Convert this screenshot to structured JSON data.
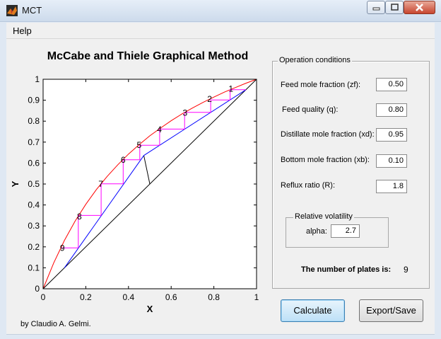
{
  "window": {
    "title": "MCT",
    "icon": "matlab-icon",
    "controls": [
      "minimize-icon",
      "maximize-icon",
      "close-icon"
    ]
  },
  "menu": {
    "help": "Help"
  },
  "chart_title": "McCabe and Thiele Graphical Method",
  "credit": "by Claudio A. Gelmi.",
  "operation_conditions": {
    "title": "Operation conditions",
    "fields": [
      {
        "label": "Feed mole fraction (zf):",
        "value": "0.50"
      },
      {
        "label": "Feed quality (q):",
        "value": "0.80"
      },
      {
        "label": "Distillate mole fraction (xd):",
        "value": "0.95"
      },
      {
        "label": "Bottom mole fraction (xb):",
        "value": "0.10"
      },
      {
        "label": "Reflux ratio (R):",
        "value": "1.8"
      }
    ],
    "volatility": {
      "title": "Relative volatility",
      "label": "alpha:",
      "value": "2.7"
    },
    "plates_label": "The number of plates is:",
    "plates_value": "9"
  },
  "buttons": {
    "calculate": "Calculate",
    "export": "Export/Save"
  },
  "colors": {
    "equilibrium": "#ff0000",
    "operating": "#0000ff",
    "steps": "#ff00ff",
    "diagonal": "#000000"
  },
  "chart_data": {
    "type": "line",
    "title": "McCabe and Thiele Graphical Method",
    "xlabel": "X",
    "ylabel": "Y",
    "xlim": [
      0,
      1
    ],
    "ylim": [
      0,
      1
    ],
    "x_ticks": [
      "0",
      "0.2",
      "0.4",
      "0.6",
      "0.8",
      "1"
    ],
    "y_ticks": [
      "0",
      "0.1",
      "0.2",
      "0.3",
      "0.4",
      "0.5",
      "0.6",
      "0.7",
      "0.8",
      "0.9",
      "1"
    ],
    "alpha": 2.7,
    "series": [
      {
        "role": "equilibrium",
        "color": "#ff0000",
        "x": [
          0,
          0.05,
          0.1,
          0.15,
          0.2,
          0.25,
          0.3,
          0.35,
          0.4,
          0.45,
          0.5,
          0.55,
          0.6,
          0.65,
          0.7,
          0.75,
          0.8,
          0.85,
          0.9,
          0.95,
          1
        ],
        "y": [
          0,
          0.124,
          0.231,
          0.323,
          0.403,
          0.474,
          0.536,
          0.592,
          0.643,
          0.688,
          0.73,
          0.767,
          0.802,
          0.834,
          0.863,
          0.89,
          0.915,
          0.939,
          0.96,
          0.981,
          1
        ]
      },
      {
        "role": "diagonal",
        "color": "#000000",
        "x": [
          0,
          1
        ],
        "y": [
          0,
          1
        ]
      },
      {
        "role": "q-line",
        "color": "#000000",
        "x": [
          0.5,
          0.472
        ],
        "y": [
          0.5,
          0.636
        ]
      },
      {
        "role": "rectifying",
        "color": "#0000ff",
        "x": [
          0.472,
          0.95
        ],
        "y": [
          0.636,
          0.95
        ]
      },
      {
        "role": "stripping",
        "color": "#0000ff",
        "x": [
          0.1,
          0.472
        ],
        "y": [
          0.1,
          0.636
        ]
      },
      {
        "role": "steps",
        "color": "#ff00ff",
        "x": [
          0.95,
          0.876,
          0.876,
          0.785,
          0.785,
          0.663,
          0.663,
          0.546,
          0.546,
          0.453,
          0.453,
          0.375,
          0.375,
          0.272,
          0.272,
          0.165,
          0.165,
          0.087
        ],
        "y": [
          0.95,
          0.95,
          0.901,
          0.901,
          0.842,
          0.842,
          0.762,
          0.762,
          0.685,
          0.685,
          0.616,
          0.616,
          0.501,
          0.501,
          0.35,
          0.35,
          0.195,
          0.195
        ]
      }
    ],
    "stage_labels": [
      {
        "text": "1",
        "x": 0.88,
        "y": 0.955
      },
      {
        "text": "2",
        "x": 0.78,
        "y": 0.905
      },
      {
        "text": "3",
        "x": 0.665,
        "y": 0.84
      },
      {
        "text": "4",
        "x": 0.545,
        "y": 0.76
      },
      {
        "text": "5",
        "x": 0.45,
        "y": 0.685
      },
      {
        "text": "6",
        "x": 0.375,
        "y": 0.615
      },
      {
        "text": "7",
        "x": 0.27,
        "y": 0.5
      },
      {
        "text": "8",
        "x": 0.17,
        "y": 0.345
      },
      {
        "text": "9",
        "x": 0.09,
        "y": 0.195
      }
    ],
    "grid": false,
    "legend": "none"
  }
}
